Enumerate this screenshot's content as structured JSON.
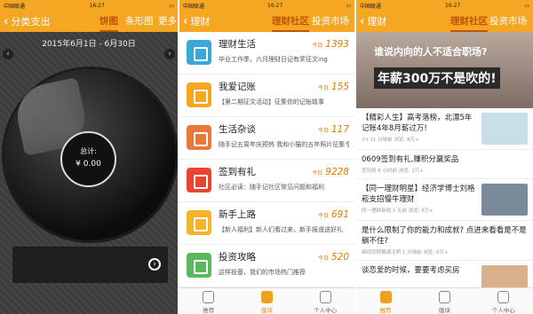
{
  "status": {
    "carrier": "中国联通",
    "time": "16:27"
  },
  "p1": {
    "title": "分类支出",
    "tabs": [
      "饼图",
      "条形图",
      "更多"
    ],
    "date_range": "2015年6月1日 - 6月30日",
    "total_label": "总计:",
    "total_value": "¥  0.00"
  },
  "p2": {
    "title": "理财",
    "tabs": [
      "理财社区",
      "投资市场"
    ],
    "today": "今日",
    "items": [
      {
        "title": "理财生活",
        "desc": "毕业工作季，六月理财日记有奖征文ing",
        "count": "1393",
        "color": "#3aa6d9"
      },
      {
        "title": "我爱记账",
        "desc": "【第二期征文活动】征集你的记账故事",
        "count": "155",
        "color": "#f5a623"
      },
      {
        "title": "生活杂谈",
        "desc": "随手记五周年庆预热 我和小猫的五年照片征集令",
        "count": "117",
        "color": "#e9793a"
      },
      {
        "title": "签到有礼",
        "desc": "社区必读：随手记社区常见问题和福利",
        "count": "9228",
        "color": "#e8442f"
      },
      {
        "title": "新手上路",
        "desc": "【新人福利】新人们看过来，新手报道送好礼",
        "count": "691",
        "color": "#f3b52a"
      },
      {
        "title": "投资攻略",
        "desc": "这样投基，我们的市场热门推荐",
        "count": "520",
        "color": "#5cb85c"
      }
    ]
  },
  "p3": {
    "title": "理财",
    "tabs": [
      "理财社区",
      "投资市场"
    ],
    "banner_line1": "谁说内向的人不适合职场?",
    "banner_line2": "年薪300万不是吹的!",
    "articles": [
      {
        "title": "【精彩人生】高考落榜，北漂5年记账4年8月薪过万!",
        "meta": "小t  11 分钟前   浏览: 8万+",
        "thumb": "#c8dfe8"
      },
      {
        "title": "0609签到有礼,赚积分赢奖品",
        "meta": "签到员   6 小时前   浏览: 2万+",
        "thumb": ""
      },
      {
        "title": "【同一理财明星】经济学博士刘格菘支招慢牛理财",
        "meta": "同一理财新闻   1 天前   浏览: 5万+",
        "thumb": "#7a8a9a"
      },
      {
        "title": "是什么限制了你的能力和成就? 点进来看看是不是躺不住?",
        "meta": "麻烦您转载请注明   1 分钟前   浏览: 8万+",
        "thumb": ""
      },
      {
        "title": "谈恋爱的时候，要要考虑买房",
        "meta": "",
        "thumb": "#d9b08c"
      }
    ]
  },
  "tabbar": [
    "推荐",
    "版块",
    "个人中心"
  ]
}
